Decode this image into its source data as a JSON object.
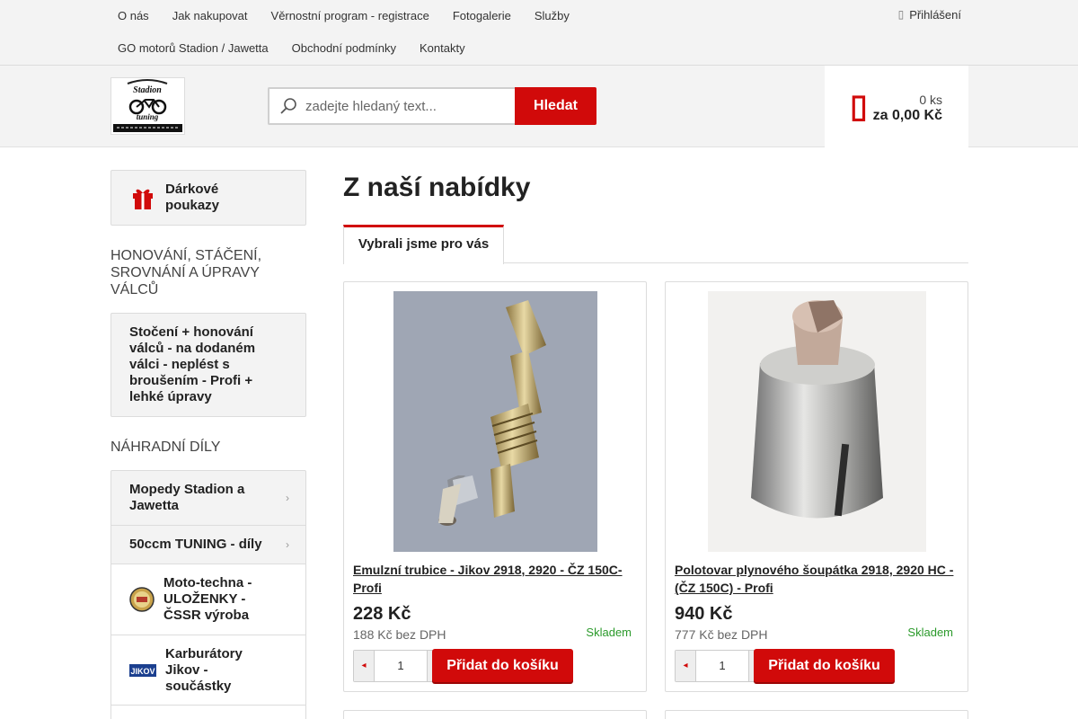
{
  "topnav": {
    "row1": [
      "O nás",
      "Jak nakupovat",
      "Věrnostní program - registrace",
      "Fotogalerie",
      "Služby"
    ],
    "row2": [
      "GO motorů Stadion / Jawetta",
      "Obchodní podmínky",
      "Kontakty"
    ],
    "login": "Přihlášení",
    "login_icon": "user-icon"
  },
  "header": {
    "logo_icon": "stadion-tuning-logo",
    "search": {
      "placeholder": "zadejte hledaný text...",
      "button": "Hledat"
    },
    "cart": {
      "count": "0 ks",
      "total": "za 0,00 Kč",
      "icon": "cart-icon"
    }
  },
  "sidebar": {
    "gift": "Dárkové poukazy",
    "heading1": "HONOVÁNÍ, STÁČENÍ, SROVNÁNÍ A ÚPRAVY VÁLCŮ",
    "honing_item": "Stočení + honování válců - na dodaném válci - neplést s broušením - Profi + lehké úpravy",
    "heading2": "NÁHRADNÍ DÍLY",
    "items": [
      "Mopedy Stadion a Jawetta",
      "50ccm TUNING - díly",
      "Moto-techna - ULOŽENKY - ČSSR výroba",
      "Karburátory Jikov - součástky"
    ]
  },
  "main": {
    "title": "Z naší nabídky",
    "tab": "Vybrali jsme pro vás",
    "products": [
      {
        "name": "Emulzní trubice - Jikov 2918, 2920 - ČZ 150C-Profi",
        "price": "228 Kč",
        "price_net": "188 Kč bez DPH",
        "stock": "Skladem",
        "qty": "1",
        "add": "Přidat do košíku"
      },
      {
        "name": "Polotovar plynového šoupátka 2918, 2920 HC - (ČZ 150C) - Profi",
        "price": "940 Kč",
        "price_net": "777 Kč bez DPH",
        "stock": "Skladem",
        "qty": "1",
        "add": "Přidat do košíku"
      }
    ]
  },
  "colors": {
    "accent": "#d10a0a",
    "stock": "#2b9a2b",
    "bar": "#f3f3f3"
  }
}
